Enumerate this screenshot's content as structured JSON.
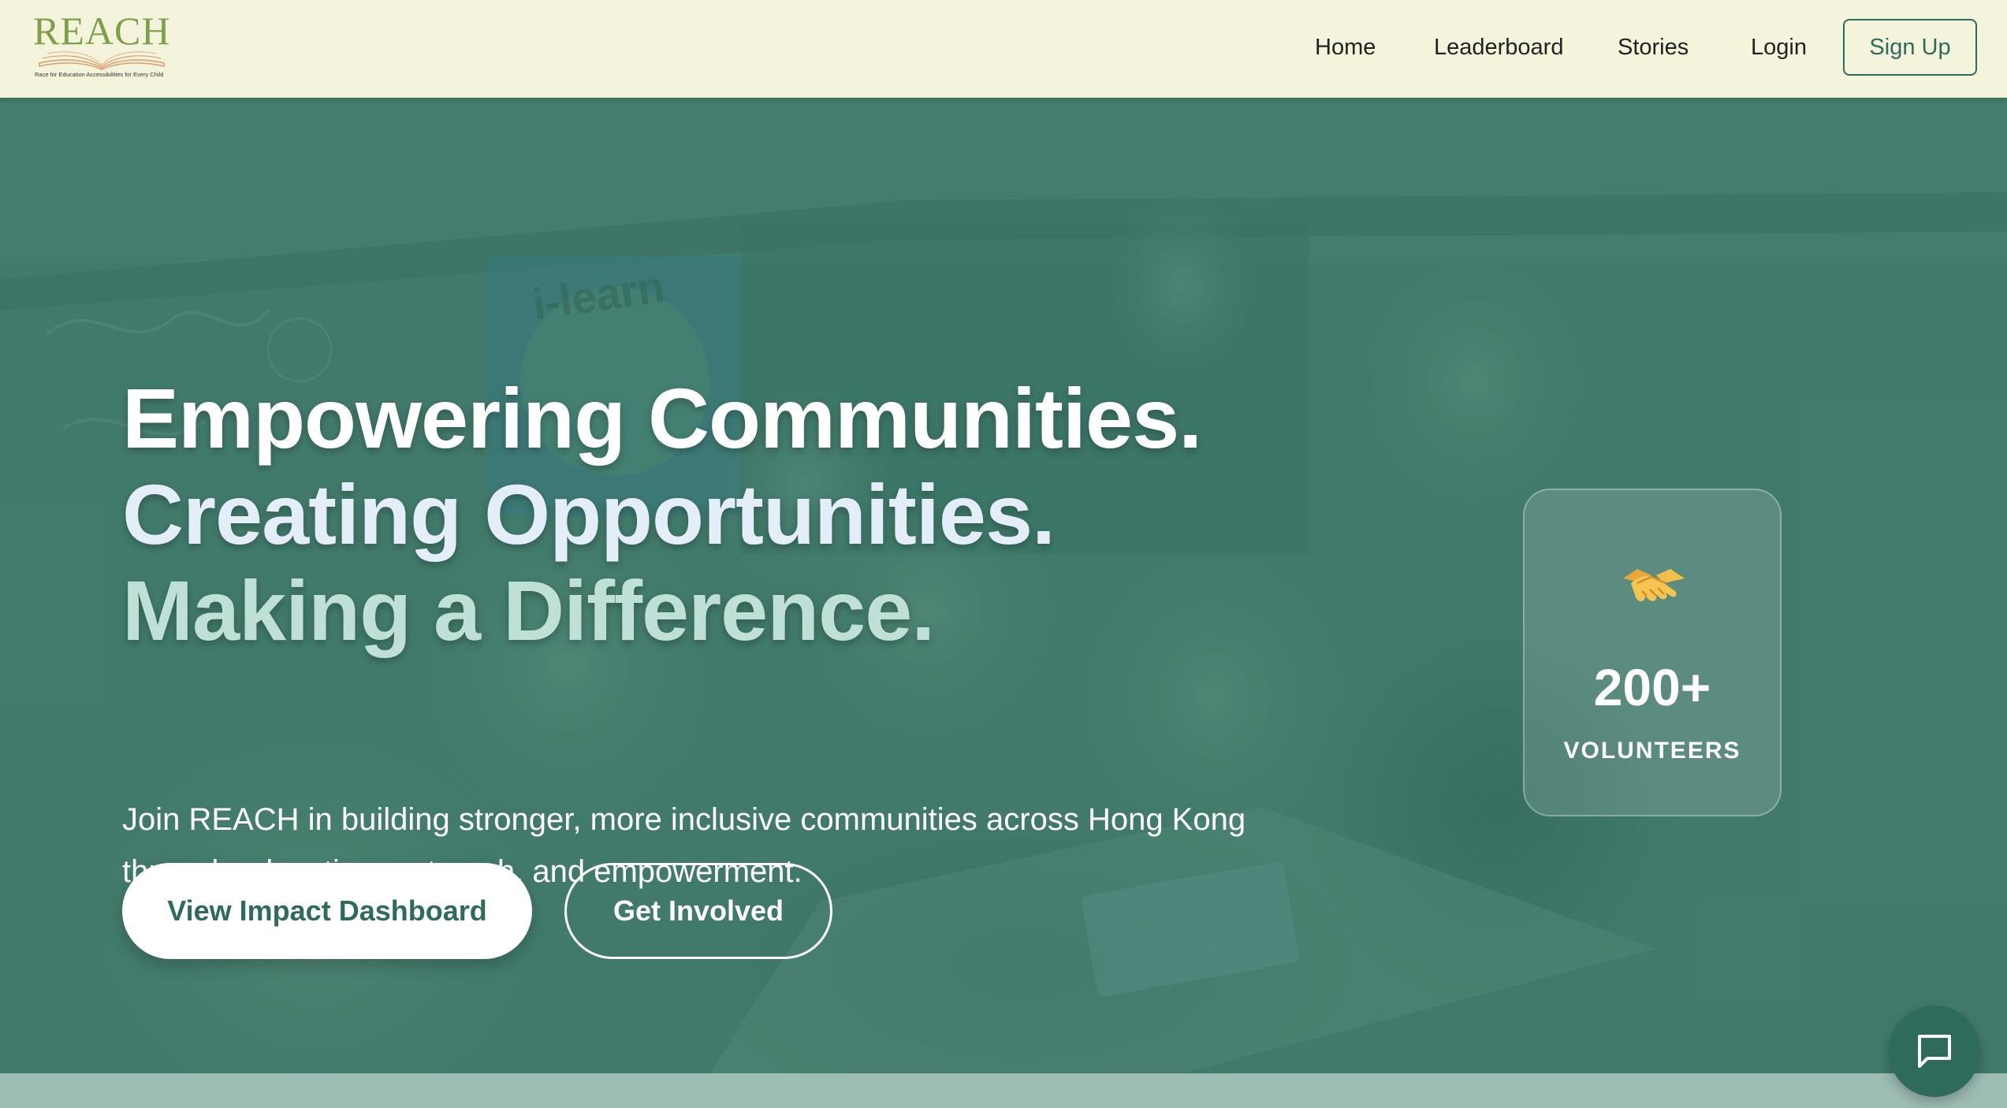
{
  "nav": {
    "logo_text": "REACH",
    "logo_tagline": "Race for Education Accessibilities for Every Child",
    "links": [
      "Home",
      "Leaderboard",
      "Stories",
      "Login"
    ],
    "signup_label": "Sign Up"
  },
  "hero": {
    "headline_1": "Empowering Communities.",
    "headline_2": "Creating Opportunities.",
    "headline_3": "Making a Difference.",
    "subtext": "Join REACH in building stronger, more inclusive communities across Hong Kong through education, outreach, and empowerment.",
    "primary_button": "View Impact Dashboard",
    "secondary_button": "Get Involved",
    "background_text": "i-learn"
  },
  "stat": {
    "icon": "handshake-icon",
    "number": "200+",
    "label": "VOLUNTEERS"
  },
  "chat": {
    "icon": "chat-bubble-icon"
  },
  "colors": {
    "nav_bg": "#f4f4dc",
    "brand_green": "#2f6b5c",
    "logo_green": "#7fa04a",
    "hero_overlay": "#3f7a6b"
  }
}
